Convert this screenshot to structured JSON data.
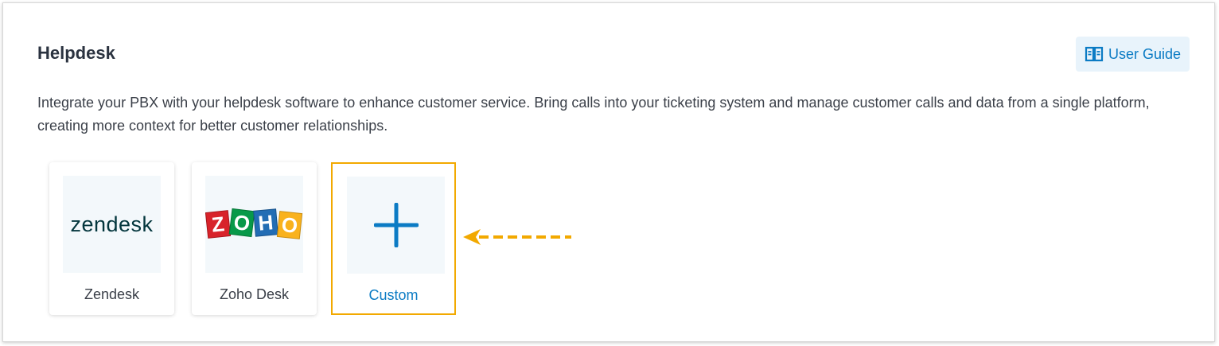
{
  "header": {
    "title": "Helpdesk",
    "user_guide_label": "User Guide"
  },
  "description": "Integrate your PBX with your helpdesk software to enhance customer service. Bring calls into your ticketing system and manage customer calls and data from a single platform, creating more context for better customer relationships.",
  "integrations": [
    {
      "name": "Zendesk",
      "logo_text": "zendesk"
    },
    {
      "name": "Zoho Desk",
      "logo_letters": [
        "Z",
        "O",
        "H",
        "O"
      ]
    },
    {
      "name": "Custom",
      "icon": "plus-icon"
    }
  ],
  "colors": {
    "accent": "#0b7bc4",
    "highlight": "#f2a900",
    "zoho_letters": [
      "#d8232a",
      "#089949",
      "#226db4",
      "#f9b21d"
    ]
  }
}
